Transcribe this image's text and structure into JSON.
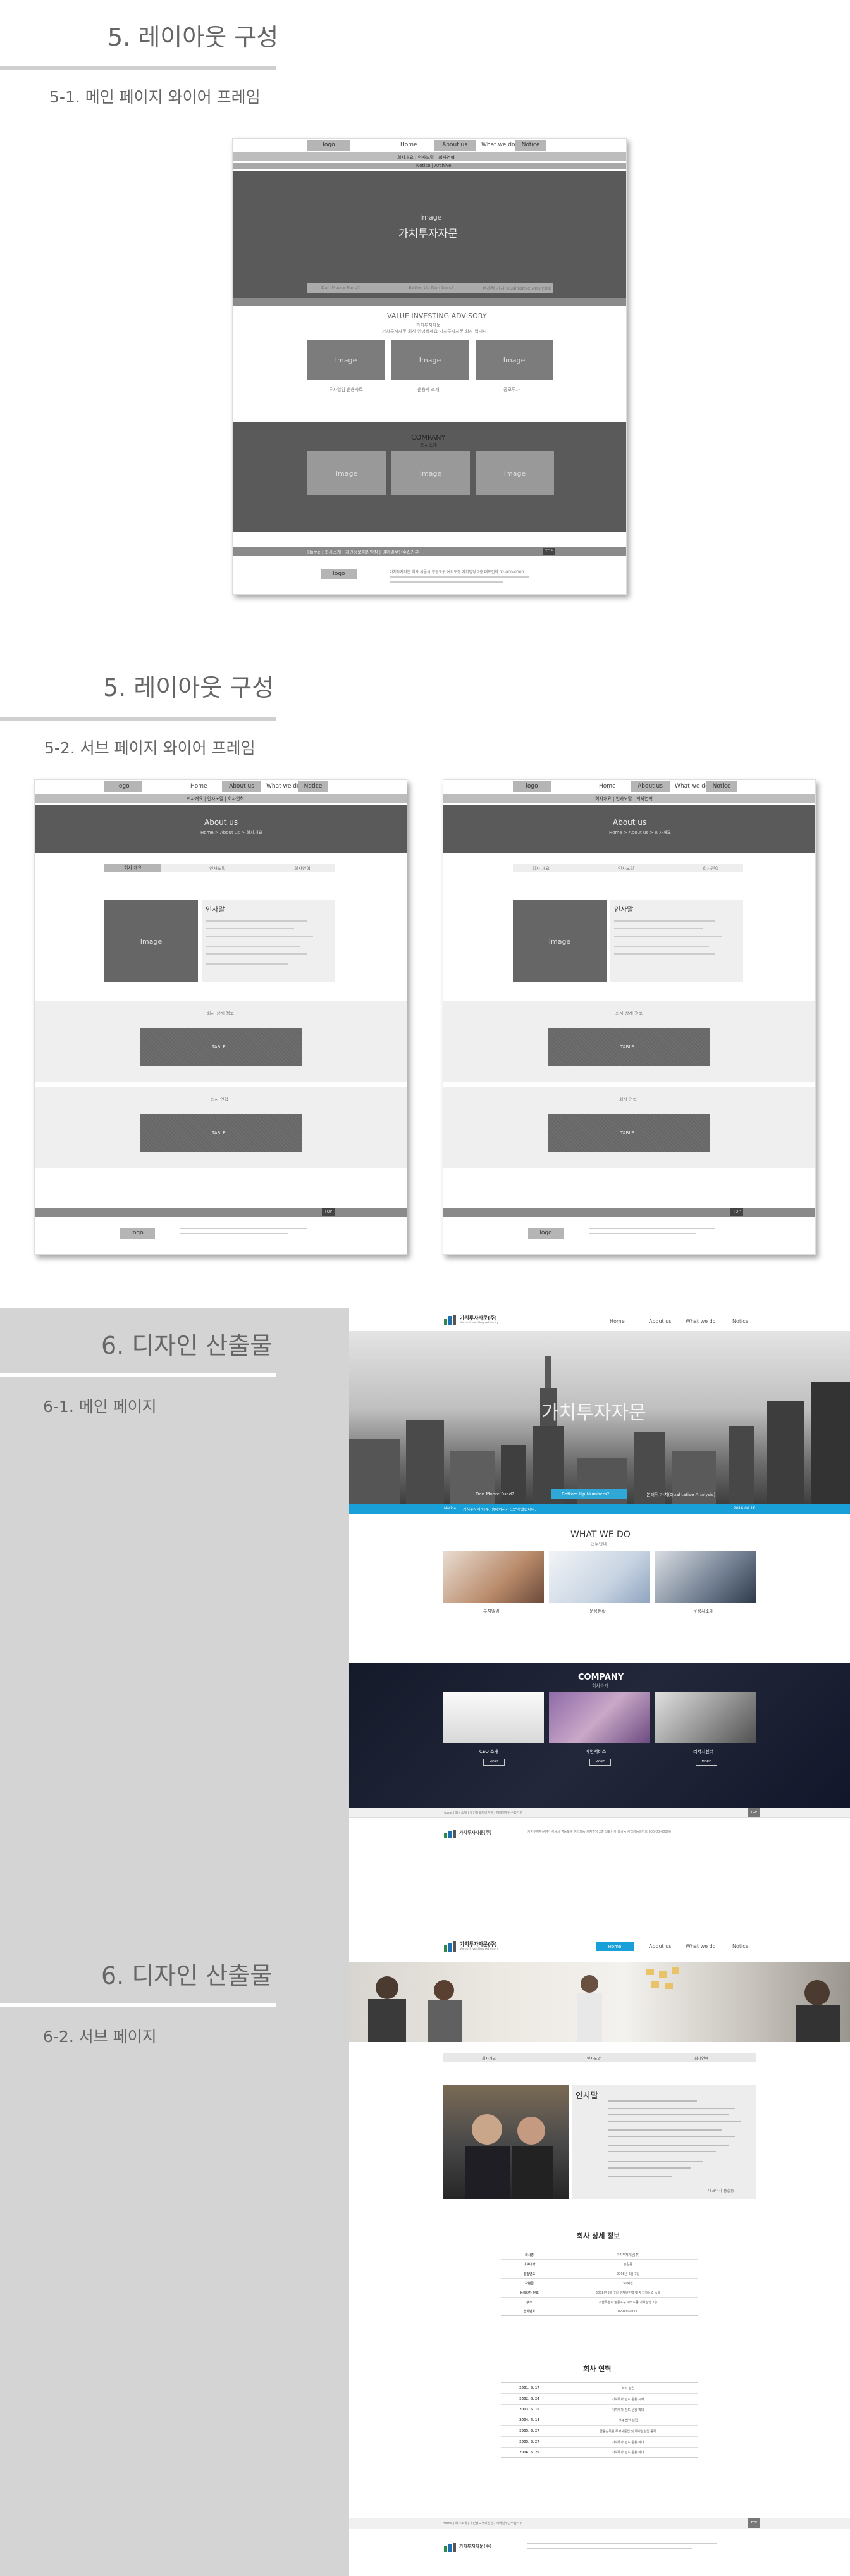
{
  "s5a": {
    "title": "5. 레이아웃 구성",
    "sub": "5-1. 메인 페이지 와이어 프레임"
  },
  "s5b": {
    "title": "5. 레이아웃 구성",
    "sub": "5-2. 서브 페이지 와이어 프레임"
  },
  "s6a": {
    "title": "6. 디자인 산출물",
    "sub": "6-1. 메인 페이지"
  },
  "s6b": {
    "title": "6. 디자인 산출물",
    "sub": "6-2. 서브 페이지"
  },
  "wf_main": {
    "logo": "logo",
    "nav": [
      "Home",
      "About us",
      "What we do",
      "Notice"
    ],
    "submenu": "회사개요 | 인사노말 | 회사연혁",
    "hero_image": "Image",
    "hero_text": "가치투자자문",
    "hero_tabs": [
      "Dan Moore Fund?",
      "Better Up Numbers?",
      "본래적 가치(Qualitative Analysis)"
    ],
    "heading": "VALUE INVESTING ADVISORY",
    "heading_sub": "가치투자자문",
    "intro": "가치투자자문 회사 안녕하세요 가치투자자문 회사 입니다",
    "cards": [
      {
        "label": "Image",
        "caption": "투자일임 운용자료"
      },
      {
        "label": "Image",
        "caption": "운용사 소개"
      },
      {
        "label": "Image",
        "caption": "공모투자"
      }
    ],
    "company": "COMPANY",
    "company_sub": "회사소개",
    "company_cards": [
      "Image",
      "Image",
      "Image"
    ],
    "footer_links": "Home | 회사소개 | 개인정보처리방침 | 이메일무단수집거부",
    "footer_btn": "TOP",
    "footer_logo": "logo",
    "footer_text": "가치투자자문 회사 서울시 영등포구 여의도동 가치빌딩 2층 대표전화 02-000-0000"
  },
  "wf_sub": {
    "logo": "logo",
    "nav": [
      "Home",
      "About us",
      "What we do",
      "Notice"
    ],
    "submenu": "회사개요 | 인사노말 | 회사연혁",
    "banner_title": "About us",
    "banner_sub": "Home > About us > 회사개요",
    "tabs": [
      "회사 개요",
      "인사노말",
      "회사연혁"
    ],
    "image": "Image",
    "greeting": "인사말",
    "section1": "회사 상세 정보",
    "section2": "회사 연혁",
    "table": "TABLE",
    "footer_btn": "TOP",
    "footer_logo": "logo"
  },
  "main_design": {
    "brand": "가치투자자문(주)",
    "brand_en": "Value Investing Advisory",
    "nav": [
      "Home",
      "About us",
      "What we do",
      "Notice"
    ],
    "hero_text": "가치투자자문",
    "hero_tabs": [
      "Dan Moore Fund?",
      "Bottom Up Numbers?",
      "본래적 가치(Qualitative Analysis)"
    ],
    "notice_left": "Notice",
    "notice_text": "가치투자자문(주) 홈페이지가 오픈하였습니다.",
    "notice_date": "2016.08.18",
    "what_title": "WHAT WE DO",
    "what_sub": "업무안내",
    "what_cards": [
      "투자일임",
      "운용현황",
      "운용사소개"
    ],
    "company_title": "COMPANY",
    "company_sub": "회사소개",
    "company_cards": [
      "CEO 소개",
      "메인서비스",
      "리서치센터"
    ],
    "more": "MORE",
    "footer_links": "Home | 회사소개 | 개인정보처리방침 | 이메일무단수집거부",
    "footer_top": "TOP",
    "footer_text": "가치투자자문(주) 서울시 영등포구 여의도동 가치빌딩 2층 대표이사 홍길동 사업자등록번호 000-00-00000"
  },
  "sub_design": {
    "brand": "가치투자자문(주)",
    "brand_en": "Value Investing Advisory",
    "nav": [
      "Home",
      "About us",
      "What we do",
      "Notice"
    ],
    "tabs": [
      "회사개요",
      "인사노말",
      "회사연혁"
    ],
    "greeting": "인사말",
    "greeting_sign": "대표이사 홍길동",
    "info_title": "회사 상세 정보",
    "info_rows": [
      [
        "회사명",
        "가치투자자문(주)"
      ],
      [
        "대표이사",
        "홍길동"
      ],
      [
        "설립연도",
        "2008년 5월 7일"
      ],
      [
        "자본금",
        "50억원"
      ],
      [
        "등록일자 번호",
        "2008년 5월 7일 투자일임업 및 투자자문업 등록"
      ],
      [
        "주소",
        "서울특별시 영등포구 여의도동 가치빌딩 2층"
      ],
      [
        "전화번호",
        "02-000-0000"
      ]
    ],
    "history_title": "회사 연혁",
    "history_rows": [
      [
        "2001. 5. 17",
        "회사 설립"
      ],
      [
        "2002. 8. 24",
        "가치투자 펀드 운용 시작"
      ],
      [
        "2003. 5. 16",
        "가치투자 펀드 운용 확대"
      ],
      [
        "2004. 4. 14",
        "신규 법인 설립"
      ],
      [
        "2005. 3. 27",
        "금융감독원 투자자문업 및 투자일임업 등록"
      ],
      [
        "2005. 5. 27",
        "가치투자 펀드 운용 확대"
      ],
      [
        "2006. 5. 26",
        "가치투자 펀드 운용 확대"
      ]
    ],
    "footer_links": "Home | 회사소개 | 개인정보처리방침 | 이메일무단수집거부",
    "footer_top": "TOP"
  }
}
